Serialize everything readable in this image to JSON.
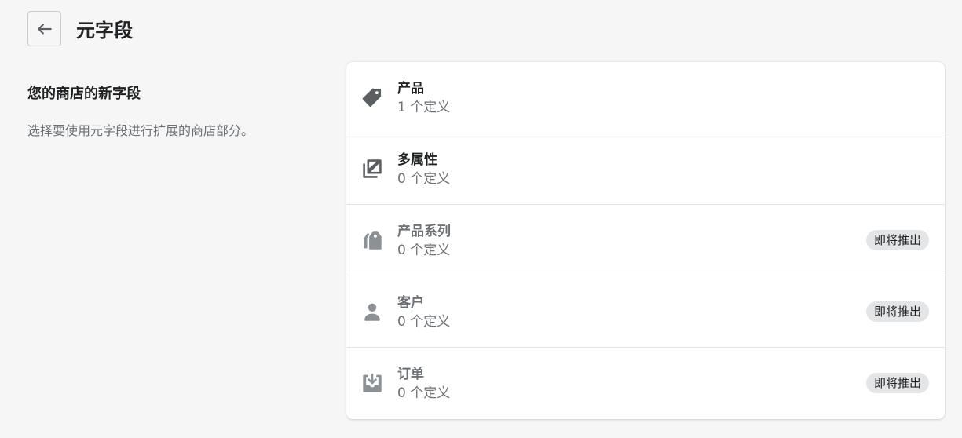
{
  "header": {
    "title": "元字段",
    "back_icon": "arrow-left-icon"
  },
  "intro": {
    "title": "您的商店的新字段",
    "description": "选择要使用元字段进行扩展的商店部分。"
  },
  "sections": [
    {
      "icon": "tag-icon",
      "title": "产品",
      "subtitle": "1 个定义",
      "badge": ""
    },
    {
      "icon": "variants-icon",
      "title": "多属性",
      "subtitle": "0 个定义",
      "badge": ""
    },
    {
      "icon": "collections-icon",
      "title": "产品系列",
      "subtitle": "0 个定义",
      "badge": "即将推出"
    },
    {
      "icon": "customer-icon",
      "title": "客户",
      "subtitle": "0 个定义",
      "badge": "即将推出"
    },
    {
      "icon": "order-icon",
      "title": "订单",
      "subtitle": "0 个定义",
      "badge": "即将推出"
    }
  ],
  "colors": {
    "background": "#f6f6f7",
    "icon_active": "#5c5f62",
    "icon_disabled": "#8c9196",
    "badge_bg": "#e4e5e7"
  }
}
